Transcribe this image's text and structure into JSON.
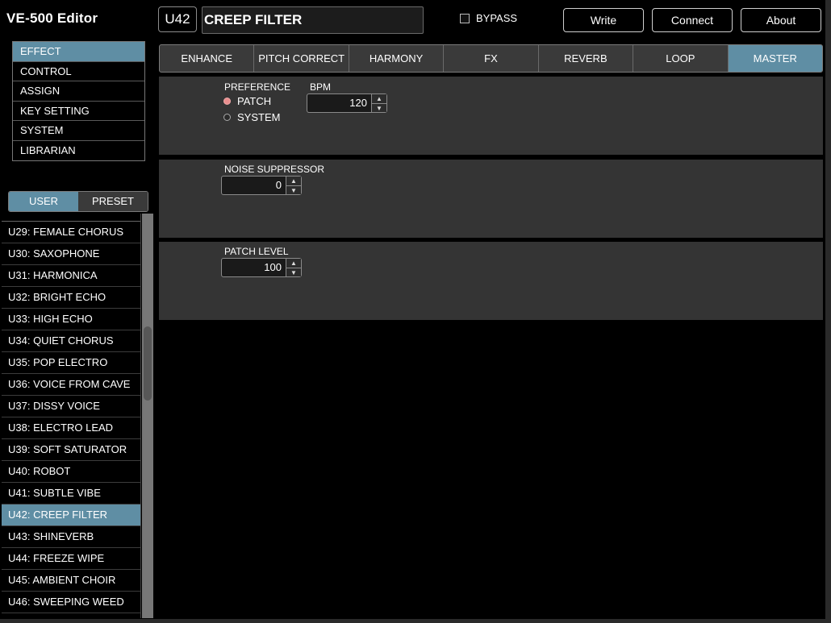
{
  "app": {
    "title": "VE-500 Editor"
  },
  "header": {
    "patch_id": "U42",
    "patch_name": "CREEP FILTER",
    "bypass_label": "BYPASS",
    "buttons": {
      "write": "Write",
      "connect": "Connect",
      "about": "About"
    }
  },
  "menu": {
    "items": [
      {
        "label": "EFFECT",
        "active": true
      },
      {
        "label": "CONTROL"
      },
      {
        "label": "ASSIGN"
      },
      {
        "label": "KEY SETTING"
      },
      {
        "label": "SYSTEM"
      },
      {
        "label": "LIBRARIAN"
      }
    ]
  },
  "bank_tabs": {
    "user": "USER",
    "preset": "PRESET",
    "selected": "USER"
  },
  "patch_list": {
    "items": [
      "U29: FEMALE CHORUS",
      "U30: SAXOPHONE",
      "U31: HARMONICA",
      "U32: BRIGHT ECHO",
      "U33: HIGH ECHO",
      "U34: QUIET CHORUS",
      "U35: POP ELECTRO",
      "U36: VOICE FROM CAVE",
      "U37: DISSY VOICE",
      "U38: ELECTRO LEAD",
      "U39: SOFT SATURATOR",
      "U40: ROBOT",
      "U41: SUBTLE VIBE",
      "U42: CREEP FILTER",
      "U43: SHINEVERB",
      "U44: FREEZE WIPE",
      "U45: AMBIENT CHOIR",
      "U46: SWEEPING WEED"
    ],
    "selected": "U42: CREEP FILTER"
  },
  "effect_tabs": {
    "items": [
      "ENHANCE",
      "PITCH CORRECT",
      "HARMONY",
      "FX",
      "REVERB",
      "LOOP",
      "MASTER"
    ],
    "selected": "MASTER"
  },
  "master": {
    "preference": {
      "label": "PREFERENCE",
      "options": [
        "PATCH",
        "SYSTEM"
      ],
      "selected": "PATCH"
    },
    "bpm": {
      "label": "BPM",
      "value": "120"
    },
    "noise_suppressor": {
      "label": "NOISE SUPPRESSOR",
      "value": "0"
    },
    "patch_level": {
      "label": "PATCH LEVEL",
      "value": "100"
    }
  },
  "icons": {
    "spin_up": "triangle-up-icon",
    "spin_down": "triangle-down-icon"
  },
  "colors": {
    "accent": "#5f8ea4",
    "panel": "#343434",
    "radio_checked": "#e98e8e"
  }
}
